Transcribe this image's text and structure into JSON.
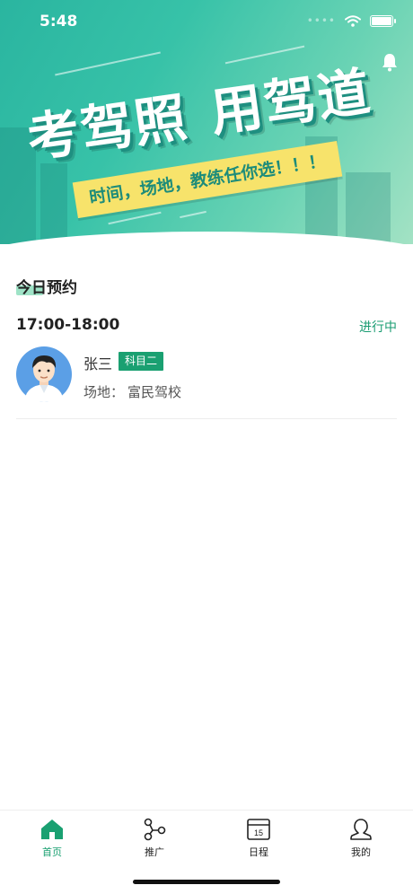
{
  "status_bar": {
    "time": "5:48",
    "icons": [
      "signal-dots-icon",
      "wifi-icon",
      "battery-icon"
    ]
  },
  "banner": {
    "slogan_left": "考驾照",
    "slogan_right": "用驾道",
    "ribbon": "时间，场地，教练任你选！！！",
    "bell_icon": "bell-icon"
  },
  "section": {
    "title": "今日预约"
  },
  "appointment": {
    "time": "17:00-18:00",
    "status": "进行中",
    "name": "张三",
    "subject_tag": "科目二",
    "venue_label": "场地：",
    "venue": "富民驾校",
    "avatar_icon": "avatar-icon"
  },
  "tabbar": {
    "items": [
      {
        "label": "首页",
        "icon": "home-icon",
        "active": true
      },
      {
        "label": "推广",
        "icon": "share-icon",
        "active": false
      },
      {
        "label": "日程",
        "icon": "calendar-icon",
        "active": false,
        "icon_text": "15"
      },
      {
        "label": "我的",
        "icon": "user-icon",
        "active": false
      }
    ]
  },
  "colors": {
    "accent": "#1aa071",
    "banner_start": "#2ab5a0",
    "banner_end": "#a3e2c4",
    "ribbon": "#f7e36b"
  }
}
